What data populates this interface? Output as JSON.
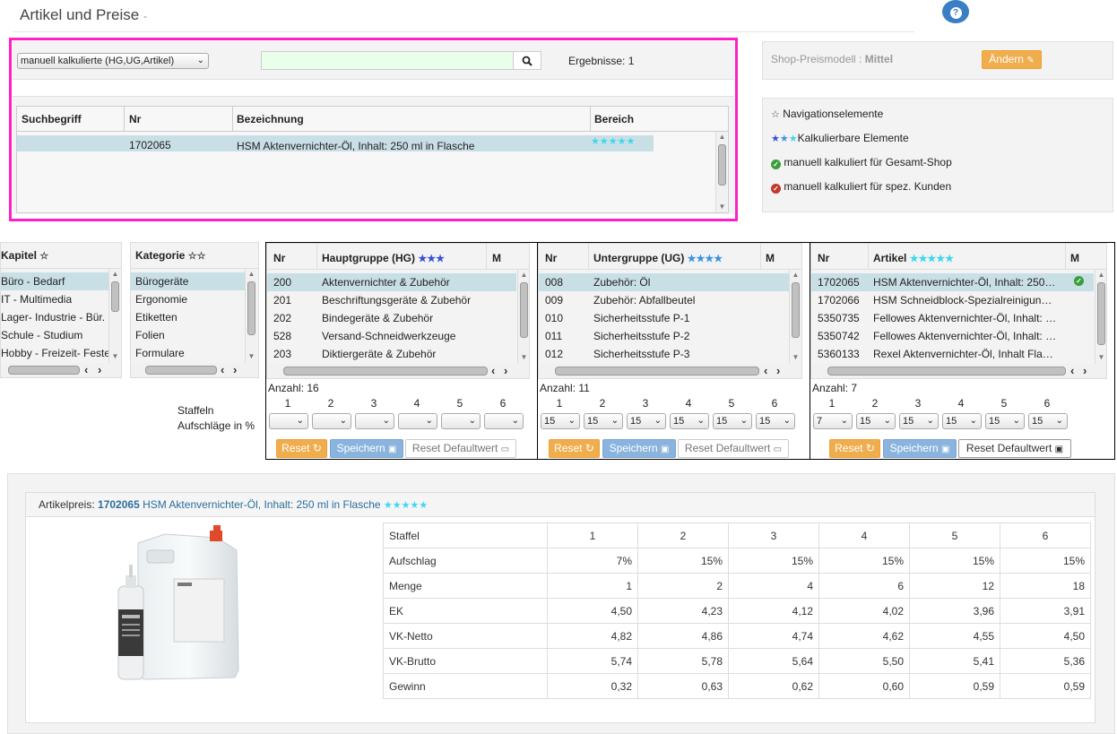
{
  "page": {
    "title": "Artikel und Preise",
    "title_suffix": "-"
  },
  "search": {
    "filter_value": "manuell kalkulierte (HG,UG,Artikel)",
    "query": "",
    "results_label": "Ergebnisse: 1",
    "columns": [
      "Suchbegriff",
      "Nr",
      "Bezeichnung",
      "Bereich"
    ],
    "rows": [
      {
        "suchbegriff": "",
        "nr": "1702065",
        "bezeichnung": "HSM Aktenvernichter-Öl, Inhalt: 250 ml in Flasche",
        "stars": 5
      }
    ]
  },
  "shop": {
    "label": "Shop-Preismodell :",
    "value": "Mittel",
    "change_label": "Ändern"
  },
  "legend": {
    "items": [
      "Navigationselemente",
      "Kalkulierbare Elemente",
      "manuell kalkuliert für Gesamt-Shop",
      "manuell kalkuliert für spez. Kunden"
    ]
  },
  "kapitel": {
    "header": "Kapitel",
    "items": [
      "Büro - Bedarf",
      "IT - Multimedia",
      "Lager- Industrie - Bür.",
      "Schule - Studium",
      "Hobby - Freizeit- Feste"
    ]
  },
  "kategorie": {
    "header": "Kategorie",
    "items": [
      "Bürogeräte",
      "Ergonomie",
      "Etiketten",
      "Folien",
      "Formulare"
    ]
  },
  "staffeln_label": "Staffeln",
  "aufschlaege_label": "Aufschläge in %",
  "hg": {
    "col_nr": "Nr",
    "col_name": "Hauptgruppe (HG)",
    "col_m": "M",
    "rows": [
      {
        "nr": "200",
        "name": "Aktenvernichter & Zubehör"
      },
      {
        "nr": "201",
        "name": "Beschriftungsgeräte & Zubehör"
      },
      {
        "nr": "202",
        "name": "Bindegeräte & Zubehör"
      },
      {
        "nr": "528",
        "name": "Versand-Schneidwerkzeuge"
      },
      {
        "nr": "203",
        "name": "Diktiergeräte & Zubehör"
      }
    ],
    "count": "Anzahl: 16",
    "steps": [
      "1",
      "2",
      "3",
      "4",
      "5",
      "6"
    ],
    "values": [
      "",
      "",
      "",
      "",
      "",
      ""
    ]
  },
  "ug": {
    "col_nr": "Nr",
    "col_name": "Untergruppe (UG)",
    "col_m": "M",
    "rows": [
      {
        "nr": "008",
        "name": "Zubehör: Öl"
      },
      {
        "nr": "009",
        "name": "Zubehör: Abfallbeutel"
      },
      {
        "nr": "010",
        "name": "Sicherheitsstufe P-1"
      },
      {
        "nr": "011",
        "name": "Sicherheitsstufe P-2"
      },
      {
        "nr": "012",
        "name": "Sicherheitsstufe P-3"
      }
    ],
    "count": "Anzahl: 11",
    "steps": [
      "1",
      "2",
      "3",
      "4",
      "5",
      "6"
    ],
    "values": [
      "15",
      "15",
      "15",
      "15",
      "15",
      "15"
    ]
  },
  "art": {
    "col_nr": "Nr",
    "col_name": "Artikel",
    "col_m": "M",
    "rows": [
      {
        "nr": "1702065",
        "name": "HSM Aktenvernichter-Öl, Inhalt: 250…"
      },
      {
        "nr": "1702066",
        "name": "HSM Schneidblock-Spezialreinigun…"
      },
      {
        "nr": "5350735",
        "name": "Fellowes Aktenvernichter-Öl, Inhalt: …"
      },
      {
        "nr": "5350742",
        "name": "Fellowes Aktenvernichter-Öl, Inhalt: …"
      },
      {
        "nr": "5360133",
        "name": "Rexel Aktenvernichter-Öl, Inhalt Fla…"
      }
    ],
    "count": "Anzahl: 7",
    "steps": [
      "1",
      "2",
      "3",
      "4",
      "5",
      "6"
    ],
    "values": [
      "7",
      "15",
      "15",
      "15",
      "15",
      "15"
    ]
  },
  "buttons": {
    "reset": "Reset",
    "save": "Speichern",
    "reset_default": "Reset Defaultwert"
  },
  "detail": {
    "label": "Artikelpreis:",
    "nr": "1702065",
    "name": "HSM Aktenvernichter-Öl, Inhalt: 250 ml in Flasche",
    "table": {
      "rows": [
        [
          "Staffel",
          "1",
          "2",
          "3",
          "4",
          "5",
          "6"
        ],
        [
          "Aufschlag",
          "7%",
          "15%",
          "15%",
          "15%",
          "15%",
          "15%"
        ],
        [
          "Menge",
          "1",
          "2",
          "4",
          "6",
          "12",
          "18"
        ],
        [
          "EK",
          "4,50",
          "4,23",
          "4,12",
          "4,02",
          "3,96",
          "3,91"
        ],
        [
          "VK-Netto",
          "4,82",
          "4,86",
          "4,74",
          "4,62",
          "4,55",
          "4,50"
        ],
        [
          "VK-Brutto",
          "5,74",
          "5,78",
          "5,64",
          "5,50",
          "5,41",
          "5,36"
        ],
        [
          "Gewinn",
          "0,32",
          "0,63",
          "0,62",
          "0,60",
          "0,59",
          "0,59"
        ]
      ]
    }
  },
  "colors": {
    "highlight": "#ff1fc8",
    "accent_orange": "#f0ad4e",
    "accent_blue": "#8ab4de",
    "link": "#2c6e9e",
    "selected_row": "#c9dfe6"
  },
  "icons": [
    "help-icon",
    "search-icon",
    "edit-icon",
    "star-icon",
    "check-icon",
    "refresh-icon",
    "save-icon",
    "reset-icon"
  ]
}
